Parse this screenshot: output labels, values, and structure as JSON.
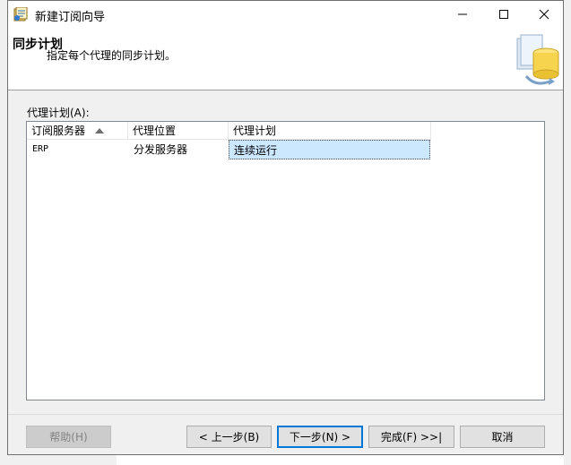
{
  "window": {
    "title": "新建订阅向导"
  },
  "header": {
    "title": "同步计划",
    "subtitle": "指定每个代理的同步计划。"
  },
  "list": {
    "label": "代理计划(A):",
    "columns": [
      "订阅服务器",
      "代理位置",
      "代理计划"
    ],
    "rows": [
      {
        "subscriber": "ERP",
        "location": "分发服务器",
        "schedule": "连续运行"
      }
    ]
  },
  "buttons": {
    "help": "帮助(H)",
    "prev": "< 上一步(B)",
    "next": "下一步(N) >",
    "finish": "完成(F) >>|",
    "cancel": "取消"
  },
  "colors": {
    "selection": "#cce8ff",
    "accent": "#0078d7"
  }
}
